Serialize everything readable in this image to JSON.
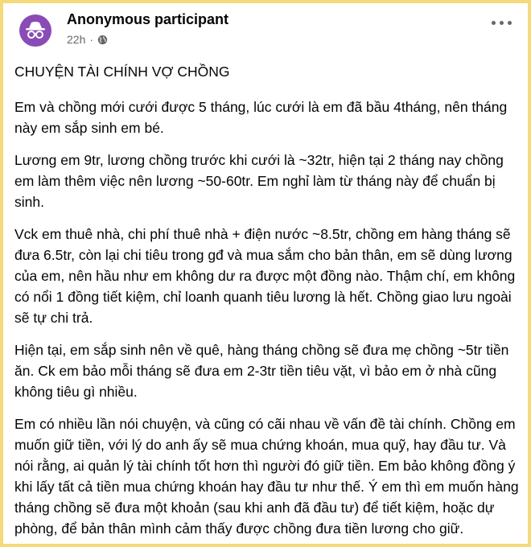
{
  "post": {
    "author": "Anonymous participant",
    "time": "22h",
    "separator": "·",
    "icons": {
      "avatar": "anonymous-incognito-icon",
      "audience": "globe-icon",
      "more": "more-options-icon"
    },
    "colors": {
      "avatar_bg": "#8a4bb7",
      "page_border": "#f5d97a"
    },
    "title": "CHUYỆN TÀI CHÍNH VỢ CHỒNG",
    "paragraphs": [
      "Em và chồng mới cưới được 5 tháng, lúc cưới là em đã bầu 4tháng, nên tháng này em sắp sinh em bé.",
      "Lương em 9tr, lương chồng trước khi cưới là ~32tr, hiện tại 2 tháng nay chồng em làm thêm việc nên lương ~50-60tr. Em nghỉ làm từ tháng này để chuẩn bị sinh.",
      "Vck em thuê nhà, chi phí thuê nhà + điện nước ~8.5tr, chồng em hàng tháng sẽ đưa 6.5tr, còn lại chi tiêu trong gđ và mua sắm cho bản thân, em sẽ dùng lương của em, nên hầu như em không dư ra được một đồng nào. Thậm chí, em không có nổi 1 đồng tiết kiệm, chỉ loanh quanh tiêu lương là hết. Chồng giao lưu ngoài sẽ tự chi trả.",
      "Hiện tại, em sắp sinh nên về quê, hàng tháng chồng sẽ đưa mẹ chồng ~5tr tiền ăn. Ck em bảo mỗi tháng sẽ đưa em 2-3tr tiền tiêu vặt, vì bảo em ở nhà cũng không tiêu gì nhiều.",
      "Em có nhiều lần nói chuyện, và cũng có cãi nhau về vấn đề tài chính. Chồng em muốn giữ tiền, với lý do anh ấy sẽ mua chứng khoán, mua quỹ, hay đầu tư. Và nói rằng, ai quản lý tài chính tốt hơn thì người đó giữ tiền. Em bảo không đồng ý khi lấy tất cả tiền mua chứng khoán hay đầu tư như thế. Ý em thì em muốn hàng tháng chồng sẽ đưa một khoản (sau khi anh đã đầu tư) để tiết kiệm, hoặc dự phòng, để bản thân mình cảm thấy được chồng đưa tiền lương cho giữ."
    ]
  }
}
